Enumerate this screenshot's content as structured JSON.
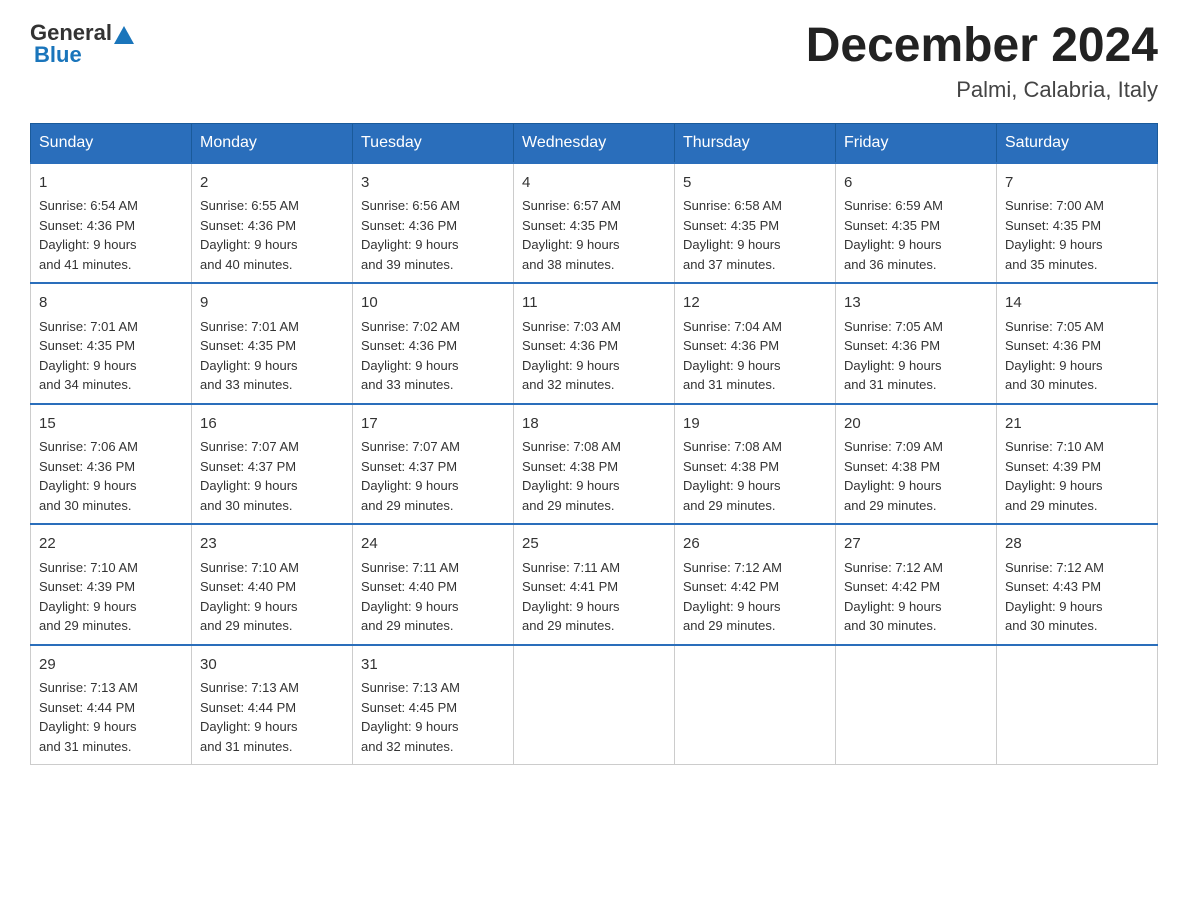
{
  "header": {
    "logo_general": "General",
    "logo_blue": "Blue",
    "title": "December 2024",
    "subtitle": "Palmi, Calabria, Italy"
  },
  "columns": [
    "Sunday",
    "Monday",
    "Tuesday",
    "Wednesday",
    "Thursday",
    "Friday",
    "Saturday"
  ],
  "weeks": [
    [
      {
        "day": "1",
        "sunrise": "6:54 AM",
        "sunset": "4:36 PM",
        "daylight": "9 hours and 41 minutes."
      },
      {
        "day": "2",
        "sunrise": "6:55 AM",
        "sunset": "4:36 PM",
        "daylight": "9 hours and 40 minutes."
      },
      {
        "day": "3",
        "sunrise": "6:56 AM",
        "sunset": "4:36 PM",
        "daylight": "9 hours and 39 minutes."
      },
      {
        "day": "4",
        "sunrise": "6:57 AM",
        "sunset": "4:35 PM",
        "daylight": "9 hours and 38 minutes."
      },
      {
        "day": "5",
        "sunrise": "6:58 AM",
        "sunset": "4:35 PM",
        "daylight": "9 hours and 37 minutes."
      },
      {
        "day": "6",
        "sunrise": "6:59 AM",
        "sunset": "4:35 PM",
        "daylight": "9 hours and 36 minutes."
      },
      {
        "day": "7",
        "sunrise": "7:00 AM",
        "sunset": "4:35 PM",
        "daylight": "9 hours and 35 minutes."
      }
    ],
    [
      {
        "day": "8",
        "sunrise": "7:01 AM",
        "sunset": "4:35 PM",
        "daylight": "9 hours and 34 minutes."
      },
      {
        "day": "9",
        "sunrise": "7:01 AM",
        "sunset": "4:35 PM",
        "daylight": "9 hours and 33 minutes."
      },
      {
        "day": "10",
        "sunrise": "7:02 AM",
        "sunset": "4:36 PM",
        "daylight": "9 hours and 33 minutes."
      },
      {
        "day": "11",
        "sunrise": "7:03 AM",
        "sunset": "4:36 PM",
        "daylight": "9 hours and 32 minutes."
      },
      {
        "day": "12",
        "sunrise": "7:04 AM",
        "sunset": "4:36 PM",
        "daylight": "9 hours and 31 minutes."
      },
      {
        "day": "13",
        "sunrise": "7:05 AM",
        "sunset": "4:36 PM",
        "daylight": "9 hours and 31 minutes."
      },
      {
        "day": "14",
        "sunrise": "7:05 AM",
        "sunset": "4:36 PM",
        "daylight": "9 hours and 30 minutes."
      }
    ],
    [
      {
        "day": "15",
        "sunrise": "7:06 AM",
        "sunset": "4:36 PM",
        "daylight": "9 hours and 30 minutes."
      },
      {
        "day": "16",
        "sunrise": "7:07 AM",
        "sunset": "4:37 PM",
        "daylight": "9 hours and 30 minutes."
      },
      {
        "day": "17",
        "sunrise": "7:07 AM",
        "sunset": "4:37 PM",
        "daylight": "9 hours and 29 minutes."
      },
      {
        "day": "18",
        "sunrise": "7:08 AM",
        "sunset": "4:38 PM",
        "daylight": "9 hours and 29 minutes."
      },
      {
        "day": "19",
        "sunrise": "7:08 AM",
        "sunset": "4:38 PM",
        "daylight": "9 hours and 29 minutes."
      },
      {
        "day": "20",
        "sunrise": "7:09 AM",
        "sunset": "4:38 PM",
        "daylight": "9 hours and 29 minutes."
      },
      {
        "day": "21",
        "sunrise": "7:10 AM",
        "sunset": "4:39 PM",
        "daylight": "9 hours and 29 minutes."
      }
    ],
    [
      {
        "day": "22",
        "sunrise": "7:10 AM",
        "sunset": "4:39 PM",
        "daylight": "9 hours and 29 minutes."
      },
      {
        "day": "23",
        "sunrise": "7:10 AM",
        "sunset": "4:40 PM",
        "daylight": "9 hours and 29 minutes."
      },
      {
        "day": "24",
        "sunrise": "7:11 AM",
        "sunset": "4:40 PM",
        "daylight": "9 hours and 29 minutes."
      },
      {
        "day": "25",
        "sunrise": "7:11 AM",
        "sunset": "4:41 PM",
        "daylight": "9 hours and 29 minutes."
      },
      {
        "day": "26",
        "sunrise": "7:12 AM",
        "sunset": "4:42 PM",
        "daylight": "9 hours and 29 minutes."
      },
      {
        "day": "27",
        "sunrise": "7:12 AM",
        "sunset": "4:42 PM",
        "daylight": "9 hours and 30 minutes."
      },
      {
        "day": "28",
        "sunrise": "7:12 AM",
        "sunset": "4:43 PM",
        "daylight": "9 hours and 30 minutes."
      }
    ],
    [
      {
        "day": "29",
        "sunrise": "7:13 AM",
        "sunset": "4:44 PM",
        "daylight": "9 hours and 31 minutes."
      },
      {
        "day": "30",
        "sunrise": "7:13 AM",
        "sunset": "4:44 PM",
        "daylight": "9 hours and 31 minutes."
      },
      {
        "day": "31",
        "sunrise": "7:13 AM",
        "sunset": "4:45 PM",
        "daylight": "9 hours and 32 minutes."
      },
      null,
      null,
      null,
      null
    ]
  ],
  "sunrise_label": "Sunrise:",
  "sunset_label": "Sunset:",
  "daylight_label": "Daylight:"
}
